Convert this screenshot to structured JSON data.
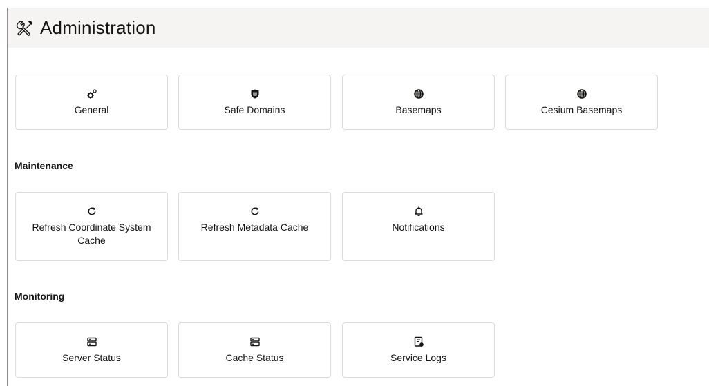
{
  "header": {
    "title": "Administration",
    "icon": "wrench-screwdriver-icon"
  },
  "sections": [
    {
      "heading": "",
      "cards": [
        {
          "label": "General",
          "icon": "gears-icon"
        },
        {
          "label": "Safe Domains",
          "icon": "shield-icon"
        },
        {
          "label": "Basemaps",
          "icon": "globe-icon"
        },
        {
          "label": "Cesium Basemaps",
          "icon": "globe-icon"
        }
      ]
    },
    {
      "heading": "Maintenance",
      "cards": [
        {
          "label": "Refresh Coordinate System Cache",
          "icon": "refresh-icon"
        },
        {
          "label": "Refresh Metadata Cache",
          "icon": "refresh-icon"
        },
        {
          "label": "Notifications",
          "icon": "bell-icon"
        }
      ]
    },
    {
      "heading": "Monitoring",
      "cards": [
        {
          "label": "Server Status",
          "icon": "server-icon"
        },
        {
          "label": "Cache Status",
          "icon": "server-icon"
        },
        {
          "label": "Service Logs",
          "icon": "log-file-icon"
        }
      ]
    }
  ]
}
